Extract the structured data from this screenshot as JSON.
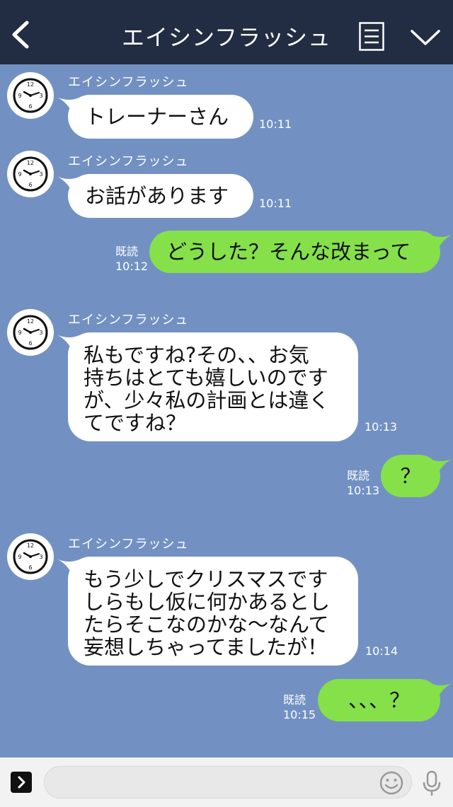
{
  "header": {
    "title": "エイシンフラッシュ",
    "back_icon": "chevron-left-icon",
    "menu_icon": "list-menu-icon",
    "collapse_icon": "chevron-down-icon"
  },
  "messages": [
    {
      "direction": "in",
      "sender": "エイシンフラッシュ",
      "lines": [
        "トレーナーさん"
      ],
      "time": "10:11"
    },
    {
      "direction": "in",
      "sender": "エイシンフラッシュ",
      "lines": [
        "お話があります"
      ],
      "time": "10:11"
    },
    {
      "direction": "out",
      "lines": [
        "どうした？そんな改まって"
      ],
      "read": "既読",
      "time": "10:12"
    },
    {
      "direction": "in",
      "sender": "エイシンフラッシュ",
      "lines": [
        "私もですね?その、、お気",
        "持ちはとても嬉しいのです",
        "が、少々私の計画とは違く",
        "てですね？"
      ],
      "time": "10:13"
    },
    {
      "direction": "out",
      "lines": [
        "？"
      ],
      "read": "既読",
      "time": "10:13"
    },
    {
      "direction": "in",
      "sender": "エイシンフラッシュ",
      "lines": [
        "もう少しでクリスマスです",
        "しらもし仮に何かあるとし",
        "たらそこなのかな〜なんて",
        "妄想しちゃってましたが！"
      ],
      "time": "10:14"
    },
    {
      "direction": "out",
      "lines": [
        "、、、？"
      ],
      "read": "既読",
      "time": "10:15"
    }
  ],
  "input_bar": {
    "placeholder": "",
    "expand_icon": "chevron-right-icon",
    "emoji_icon": "smiley-icon",
    "mic_icon": "microphone-icon"
  },
  "colors": {
    "header_bg": "#222c42",
    "chat_bg": "#7291c2",
    "incoming_bubble": "#ffffff",
    "outgoing_bubble": "#85e04a"
  }
}
